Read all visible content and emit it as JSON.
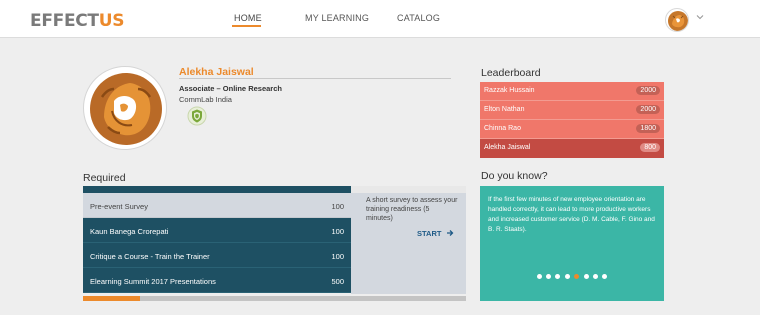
{
  "header": {
    "logo_main": "EFFECT",
    "logo_accent": "US",
    "nav": {
      "home": "HOME",
      "my_learning": "MY LEARNING",
      "catalog": "CATALOG"
    }
  },
  "profile": {
    "name": "Alekha Jaiswal",
    "role": "Associate – Online Research",
    "organization": "CommLab India"
  },
  "leaderboard": {
    "title": "Leaderboard",
    "rows": [
      {
        "name": "Razzak Hussain",
        "score": "2000"
      },
      {
        "name": "Elton Nathan",
        "score": "2000"
      },
      {
        "name": "Chinna Rao",
        "score": "1800"
      },
      {
        "name": "Alekha Jaiswal",
        "score": "800"
      }
    ]
  },
  "required": {
    "title": "Required",
    "items": [
      {
        "name": "Pre-event Survey",
        "score": "100"
      },
      {
        "name": "Kaun Banega Crorepati",
        "score": "100"
      },
      {
        "name": "Critique a Course - Train the Trainer",
        "score": "100"
      },
      {
        "name": "Elearning Summit 2017 Presentations",
        "score": "500"
      }
    ],
    "description": "A short survey to assess your training readiness (5 minutes)",
    "start_label": "START",
    "progress_fraction": 0.15
  },
  "did_you_know": {
    "title": "Do you know?",
    "text": "If the first few minutes of new employee orientation are handled correctly, it can lead to more productive workers and increased customer service (D. M. Cable, F. Gino and B. R. Staats).",
    "dot_count": 8,
    "active_dot": 4
  },
  "colors": {
    "accent": "#ec8a2c",
    "leaderboard": "#f0776a",
    "leaderboard_me": "#c34b43",
    "required_dark": "#1e5063",
    "teal": "#3bb6a6"
  }
}
